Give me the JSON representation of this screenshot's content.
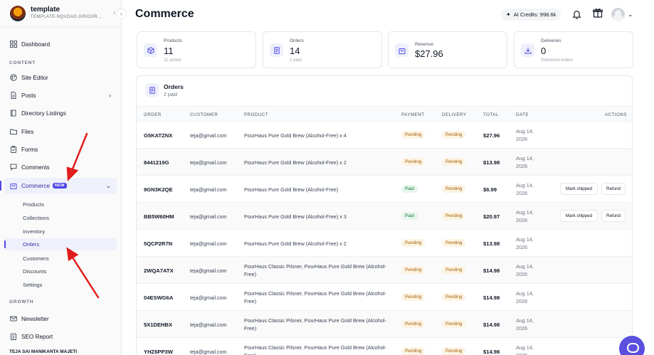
{
  "brand": {
    "name": "template",
    "subtitle": "TEMPLATE-NQVDAG.GRIGOR..."
  },
  "sidebar": {
    "top_items": [
      {
        "label": "Dashboard",
        "icon": "grid-icon"
      }
    ],
    "sections": {
      "content": "CONTENT",
      "growth": "GROWTH"
    },
    "content_items": [
      {
        "label": "Site Editor",
        "icon": "palette-icon"
      },
      {
        "label": "Posts",
        "icon": "document-icon"
      },
      {
        "label": "Directory Listings",
        "icon": "book-icon"
      },
      {
        "label": "Files",
        "icon": "folder-icon"
      },
      {
        "label": "Forms",
        "icon": "clipboard-icon"
      },
      {
        "label": "Comments",
        "icon": "comment-icon"
      },
      {
        "label": "Commerce",
        "icon": "bag-icon",
        "badge": "NEW"
      }
    ],
    "commerce_sub": [
      "Products",
      "Collections",
      "Inventory",
      "Orders",
      "Customers",
      "Discounts",
      "Settings"
    ],
    "growth_items": [
      {
        "label": "Newsletter",
        "icon": "mail-icon"
      },
      {
        "label": "SEO Report",
        "icon": "report-icon"
      }
    ],
    "user_name": "TEJA SAI MANIKANTA MAJETI"
  },
  "header": {
    "title": "Commerce",
    "credits": "AI Credits: 998.6k"
  },
  "stats": [
    {
      "label": "Products",
      "value": "11",
      "sub": "11 active",
      "icon": "box-icon"
    },
    {
      "label": "Orders",
      "value": "14",
      "sub": "2 paid",
      "icon": "receipt-icon"
    },
    {
      "label": "Revenue",
      "value": "$27.96",
      "sub": "",
      "icon": "bag-icon"
    },
    {
      "label": "Deliveries",
      "value": "0",
      "sub": "Delivered orders",
      "icon": "download-icon"
    }
  ],
  "orders": {
    "title": "Orders",
    "subtitle": "2 paid",
    "columns": [
      "ORDER",
      "CUSTOMER",
      "PRODUCT",
      "PAYMENT",
      "DELIVERY",
      "TOTAL",
      "DATE",
      "ACTIONS"
    ],
    "rows": [
      {
        "order": "G5KATZNX",
        "customer": "teja@gmail.com",
        "product": "PourHaus Pure Gold Brew (Alcohol-Free) x 4",
        "payment": "Pending",
        "delivery": "Pending",
        "total": "$27.96",
        "date": "Aug 14, 2026",
        "actions": []
      },
      {
        "order": "8441219G",
        "customer": "teja@gmail.com",
        "product": "PourHaus Pure Gold Brew (Alcohol-Free) x 2",
        "payment": "Pending",
        "delivery": "Pending",
        "total": "$13.98",
        "date": "Aug 14, 2026",
        "actions": []
      },
      {
        "order": "9GN3K2QE",
        "customer": "teja@gmail.com",
        "product": "PourHaus Pure Gold Brew (Alcohol-Free)",
        "payment": "Paid",
        "delivery": "Pending",
        "total": "$6.99",
        "date": "Aug 14, 2026",
        "actions": [
          "Mark shipped",
          "Refund"
        ]
      },
      {
        "order": "BB5W60HM",
        "customer": "teja@gmail.com",
        "product": "PourHaus Pure Gold Brew (Alcohol-Free) x 3",
        "payment": "Paid",
        "delivery": "Pending",
        "total": "$20.97",
        "date": "Aug 14, 2026",
        "actions": [
          "Mark shipped",
          "Refund"
        ]
      },
      {
        "order": "5QCP2R7N",
        "customer": "teja@gmail.com",
        "product": "PourHaus Pure Gold Brew (Alcohol-Free) x 2",
        "payment": "Pending",
        "delivery": "Pending",
        "total": "$13.98",
        "date": "Aug 14, 2026",
        "actions": []
      },
      {
        "order": "2WQA7ATX",
        "customer": "teja@gmail.com",
        "product": "PourHaus Classic Pilsner, PourHaus Pure Gold Brew (Alcohol-Free)",
        "payment": "Pending",
        "delivery": "Pending",
        "total": "$14.98",
        "date": "Aug 14, 2026",
        "actions": []
      },
      {
        "order": "04ESWG6A",
        "customer": "teja@gmail.com",
        "product": "PourHaus Classic Pilsner, PourHaus Pure Gold Brew (Alcohol-Free)",
        "payment": "Pending",
        "delivery": "Pending",
        "total": "$14.98",
        "date": "Aug 14, 2026",
        "actions": []
      },
      {
        "order": "5X1DEHBX",
        "customer": "teja@gmail.com",
        "product": "PourHaus Classic Pilsner, PourHaus Pure Gold Brew (Alcohol-Free)",
        "payment": "Pending",
        "delivery": "Pending",
        "total": "$14.98",
        "date": "Aug 14, 2026",
        "actions": []
      },
      {
        "order": "YHZ6PP3W",
        "customer": "teja@gmail.com",
        "product": "PourHaus Classic Pilsner, PourHaus Pure Gold Brew (Alcohol-Free)",
        "payment": "Pending",
        "delivery": "Pending",
        "total": "$14.98",
        "date": "Aug 14, 2026",
        "actions": []
      }
    ]
  },
  "colors": {
    "accent": "#4f46e5",
    "annotation": "#e11d1d",
    "pending_bg": "#fdf3e3",
    "paid_bg": "#e7f6ec"
  }
}
